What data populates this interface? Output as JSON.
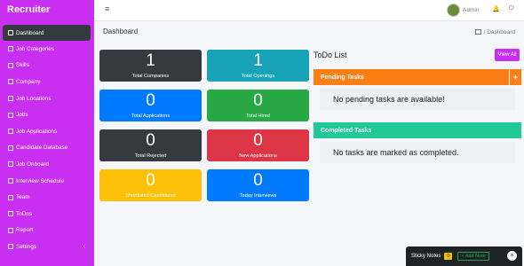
{
  "app": {
    "brand": "Recruiter"
  },
  "sidebar": {
    "items": [
      {
        "label": "Dashboard",
        "icon": "gauge-icon"
      },
      {
        "label": "Job Categories",
        "icon": "grid-icon"
      },
      {
        "label": "Skills",
        "icon": "grid-icon"
      },
      {
        "label": "Company",
        "icon": "building-icon"
      },
      {
        "label": "Job Locations",
        "icon": "map-pin-icon"
      },
      {
        "label": "Jobs",
        "icon": "user-icon"
      },
      {
        "label": "Job Applications",
        "icon": "user-icon"
      },
      {
        "label": "Candidate Database",
        "icon": "database-icon"
      },
      {
        "label": "Job Onboard",
        "icon": "user-icon"
      },
      {
        "label": "Interview Schedule",
        "icon": "calendar-icon"
      },
      {
        "label": "Team",
        "icon": "team-icon"
      },
      {
        "label": "ToDos",
        "icon": "list-icon"
      },
      {
        "label": "Report",
        "icon": "chart-icon"
      },
      {
        "label": "Settings",
        "icon": "gear-icon"
      }
    ],
    "settings_chevron": "‹"
  },
  "topbar": {
    "menu_icon": "≡",
    "username": "Admin",
    "bell_icon": "🔔",
    "power_icon": "⏻"
  },
  "page": {
    "title": "Dashboard",
    "breadcrumb": "Dashboard"
  },
  "stats": [
    {
      "value": "1",
      "label": "Total Companies",
      "color": "#343a40"
    },
    {
      "value": "1",
      "label": "Total Openings",
      "color": "#17a2b8"
    },
    {
      "value": "0",
      "label": "Total Applications",
      "color": "#007bff"
    },
    {
      "value": "0",
      "label": "Total Hired",
      "color": "#28a745"
    },
    {
      "value": "0",
      "label": "Total Rejected",
      "color": "#343a40"
    },
    {
      "value": "0",
      "label": "New Applications",
      "color": "#dc3545"
    },
    {
      "value": "0",
      "label": "Shortlisted Candidates",
      "color": "#ffc107"
    },
    {
      "value": "0",
      "label": "Today Interviews",
      "color": "#007bff"
    }
  ],
  "todo": {
    "title": "ToDo List",
    "view_all": "View All",
    "pending": {
      "title": "Pending Tasks",
      "message": "No pending tasks are available!",
      "plus": "+",
      "color": "#fd7e14"
    },
    "completed": {
      "title": "Completed Tasks",
      "message": "No tasks are marked as completed.",
      "color": "#20c997"
    }
  },
  "sticky": {
    "title": "Sticky Notes",
    "count": "0",
    "add_label": "+ Add Note",
    "toggle": "˄"
  }
}
